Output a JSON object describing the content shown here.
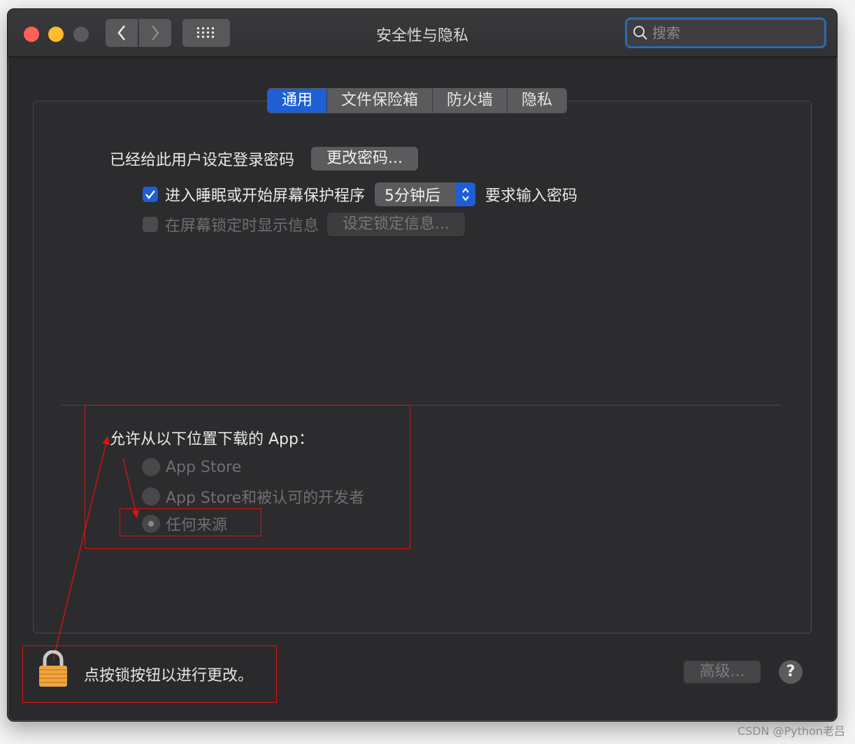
{
  "window": {
    "title": "安全性与隐私",
    "search_placeholder": "搜索"
  },
  "tabs": [
    {
      "label": "通用",
      "active": true
    },
    {
      "label": "文件保险箱",
      "active": false
    },
    {
      "label": "防火墙",
      "active": false
    },
    {
      "label": "隐私",
      "active": false
    }
  ],
  "general": {
    "login_password_label": "已经给此用户设定登录密码",
    "change_password_button": "更改密码...",
    "require_password": {
      "checked": true,
      "label_before": "进入睡眠或开始屏幕保护程序",
      "delay_value": "5分钟后",
      "label_after": "要求输入密码"
    },
    "lock_message": {
      "checked": false,
      "label": "在屏幕锁定时显示信息",
      "button": "设定锁定信息..."
    }
  },
  "downloads": {
    "heading": "允许从以下位置下载的 App：",
    "options": [
      {
        "label": "App Store",
        "selected": false
      },
      {
        "label": "App Store和被认可的开发者",
        "selected": false
      },
      {
        "label": "任何来源",
        "selected": true
      }
    ]
  },
  "footer": {
    "lock_text": "点按锁按钮以进行更改。",
    "advanced_button": "高级...",
    "help_button": "?"
  },
  "watermark": "CSDN @Python老吕",
  "colors": {
    "accent": "#1f5fd6",
    "annotation": "#e01010",
    "window_bg": "#2a2a2c"
  }
}
